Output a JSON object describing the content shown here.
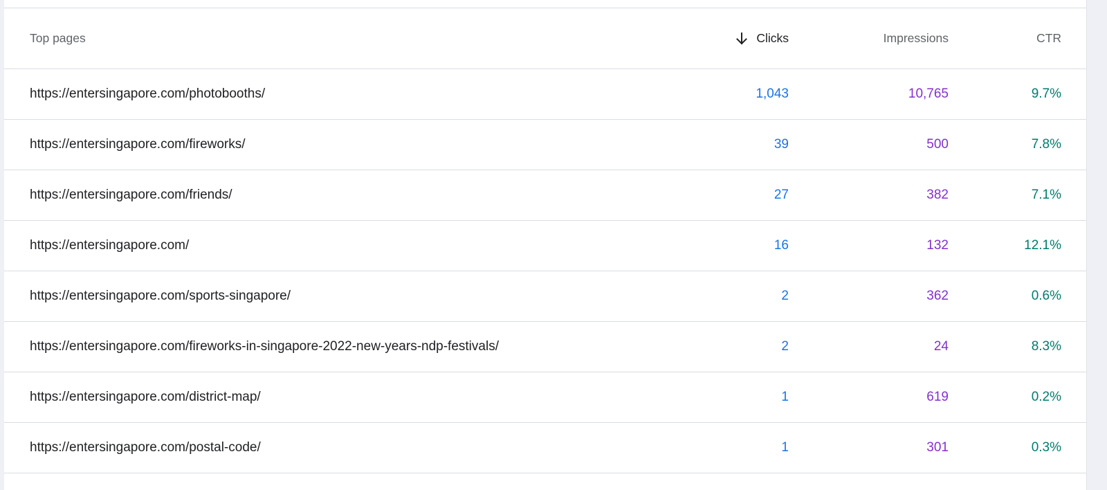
{
  "table": {
    "headers": {
      "page": "Top pages",
      "clicks": "Clicks",
      "impressions": "Impressions",
      "ctr": "CTR"
    },
    "sort": {
      "column": "clicks",
      "direction": "descending",
      "icon": "arrow-down-icon"
    },
    "rows": [
      {
        "page": "https://entersingapore.com/photobooths/",
        "clicks": "1,043",
        "impressions": "10,765",
        "ctr": "9.7%"
      },
      {
        "page": "https://entersingapore.com/fireworks/",
        "clicks": "39",
        "impressions": "500",
        "ctr": "7.8%"
      },
      {
        "page": "https://entersingapore.com/friends/",
        "clicks": "27",
        "impressions": "382",
        "ctr": "7.1%"
      },
      {
        "page": "https://entersingapore.com/",
        "clicks": "16",
        "impressions": "132",
        "ctr": "12.1%"
      },
      {
        "page": "https://entersingapore.com/sports-singapore/",
        "clicks": "2",
        "impressions": "362",
        "ctr": "0.6%"
      },
      {
        "page": "https://entersingapore.com/fireworks-in-singapore-2022-new-years-ndp-festivals/",
        "clicks": "2",
        "impressions": "24",
        "ctr": "8.3%"
      },
      {
        "page": "https://entersingapore.com/district-map/",
        "clicks": "1",
        "impressions": "619",
        "ctr": "0.2%"
      },
      {
        "page": "https://entersingapore.com/postal-code/",
        "clicks": "1",
        "impressions": "301",
        "ctr": "0.3%"
      }
    ]
  },
  "colors": {
    "clicks": "#1a73e8",
    "impressions": "#8430ce",
    "ctr": "#007b6c"
  }
}
